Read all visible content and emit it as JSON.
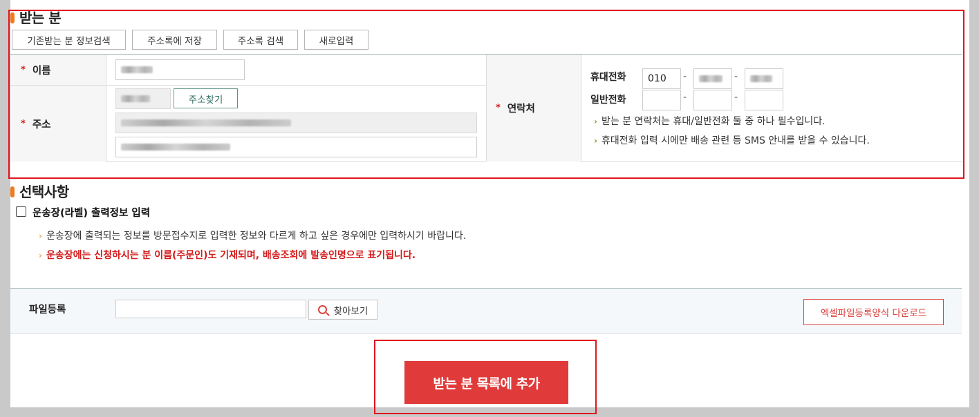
{
  "recipient": {
    "title": "받는 분",
    "buttons": [
      "기존받는 분 정보검색",
      "주소록에 저장",
      "주소록 검색",
      "새로입력"
    ],
    "name_label": "이름",
    "address_label": "주소",
    "find_address_label": "주소찾기",
    "contact_label": "연락처",
    "required_mark": "*",
    "mobile_label": "휴대전화",
    "phone_label": "일반전화",
    "mobile_prefix": "010",
    "dash": "-",
    "notes": [
      "받는 분 연락처는 휴대/일반전화 둘 중 하나 필수입니다.",
      "휴대전화 입력 시에만 배송 관련 등 SMS 안내를 받을 수 있습니다."
    ]
  },
  "options": {
    "title": "선택사항",
    "checkbox_label": "운송장(라벨) 출력정보 입력",
    "checked": false,
    "note1": "운송장에 출력되는 정보를 방문접수지로 입력한 정보와 다르게 하고 싶은 경우에만 입력하시기 바랍니다.",
    "note2": "운송장에는 신청하시는 분 이름(주문인)도 기재되며, 배송조회에 발송인명으로 표기됩니다."
  },
  "file": {
    "label": "파일등록",
    "browse_label": "찾아보기",
    "excel_label": "엑셀파일등록양식 다운로드"
  },
  "add_button_label": "받는 분 목록에 추가",
  "colors": {
    "accent_red": "#e03a3a",
    "orange_bar": "#f07b1e",
    "green_border": "#5e958a"
  }
}
